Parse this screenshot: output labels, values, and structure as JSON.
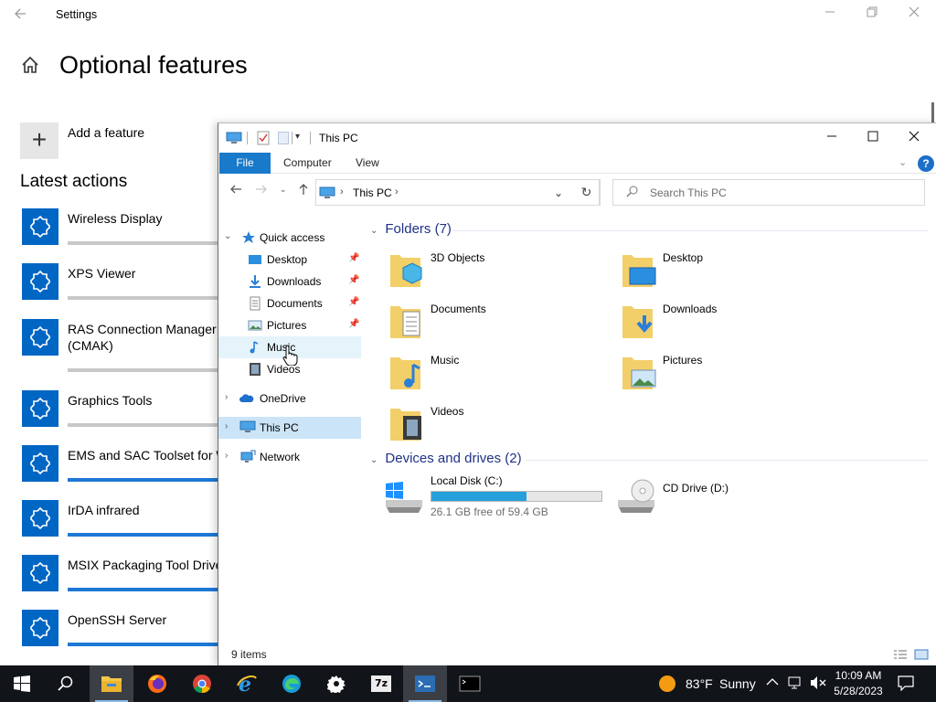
{
  "settings": {
    "window_title": "Settings",
    "page_title": "Optional features",
    "add_feature_label": "Add a feature",
    "latest_actions_heading": "Latest actions",
    "features": [
      {
        "name": "Wireless Display",
        "status": "grey"
      },
      {
        "name": "XPS Viewer",
        "status": "grey"
      },
      {
        "name": "RAS Connection Manager Administration Kit",
        "name_line2": "(CMAK)",
        "status": "grey"
      },
      {
        "name": "Graphics Tools",
        "status": "grey"
      },
      {
        "name": "EMS and SAC Toolset for Windows Server",
        "status": "blue"
      },
      {
        "name": "IrDA infrared",
        "status": "blue"
      },
      {
        "name": "MSIX Packaging Tool Driver",
        "status": "blue"
      },
      {
        "name": "OpenSSH Server",
        "status": "blue"
      }
    ]
  },
  "explorer": {
    "title": "This PC",
    "ribbon_tabs": {
      "file": "File",
      "computer": "Computer",
      "view": "View"
    },
    "help": "?",
    "address": {
      "crumb": "This PC"
    },
    "search_placeholder": "Search This PC",
    "nav": {
      "quick_access": "Quick access",
      "desktop": "Desktop",
      "downloads": "Downloads",
      "documents": "Documents",
      "pictures": "Pictures",
      "music": "Music",
      "videos": "Videos",
      "onedrive": "OneDrive",
      "this_pc": "This PC",
      "network": "Network"
    },
    "folders_heading": "Folders (7)",
    "folders": {
      "objects3d": "3D Objects",
      "desktop": "Desktop",
      "documents": "Documents",
      "downloads": "Downloads",
      "music": "Music",
      "pictures": "Pictures",
      "videos": "Videos"
    },
    "drives_heading": "Devices and drives (2)",
    "drives": {
      "c_name": "Local Disk (C:)",
      "c_free": "26.1 GB free of 59.4 GB",
      "c_used_fraction": 0.56,
      "d_name": "CD Drive (D:)"
    },
    "status_items": "9 items"
  },
  "taskbar": {
    "weather_temp": "83°F",
    "weather_desc": "Sunny",
    "time": "10:09 AM",
    "date": "5/28/2023",
    "sevenzip_label": "7z"
  },
  "colors": {
    "accent": "#0066c4",
    "ribbon_file": "#1979ca",
    "selection": "#cce4f7",
    "drive_fill": "#26a0da",
    "taskbar": "#111419"
  }
}
